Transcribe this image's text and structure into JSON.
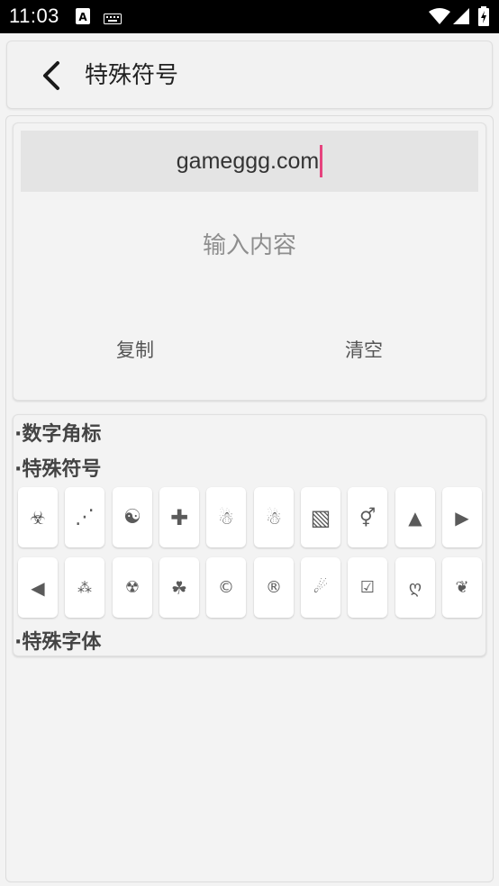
{
  "status_bar": {
    "time": "11:03"
  },
  "app_bar": {
    "title": "特殊符号"
  },
  "editor": {
    "output_text": "gameggg.com",
    "input_placeholder": "输入内容",
    "copy_label": "复制",
    "clear_label": "清空"
  },
  "sections": {
    "digit_superscript": "·数字角标",
    "special_symbols": "·特殊符号",
    "special_fonts": "·特殊字体"
  },
  "symbols_row1": [
    "☣",
    "⋰",
    "☯",
    "✚",
    "☃",
    "☃",
    "▧",
    "⚥",
    "▲",
    "▶"
  ],
  "symbols_row2": [
    "◀",
    "⁂",
    "☢",
    "☘",
    "©",
    "®",
    "☄",
    "☑",
    "ღ",
    "❦"
  ],
  "colors": {
    "caret": "#e6437e",
    "status_bar": "#000000",
    "background": "#f3f3f3"
  }
}
